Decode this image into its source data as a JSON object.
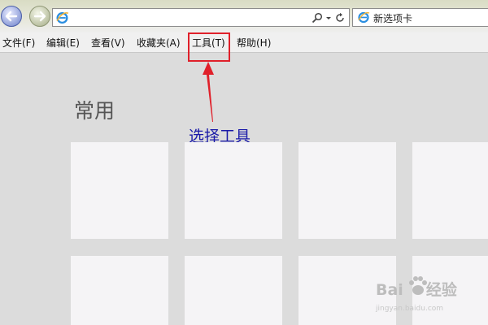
{
  "tab": {
    "title": "新选项卡"
  },
  "address": {
    "value": ""
  },
  "menu": [
    {
      "label": "文件(F)"
    },
    {
      "label": "编辑(E)"
    },
    {
      "label": "查看(V)"
    },
    {
      "label": "收藏夹(A)"
    },
    {
      "label": "工具(T)"
    },
    {
      "label": "帮助(H)"
    }
  ],
  "annotation": {
    "text": "选择工具",
    "color": "#1a1aa8",
    "highlight_color": "#e0202a"
  },
  "section": {
    "title": "常用"
  },
  "tiles_count": 8,
  "watermark": {
    "brand": "Bai",
    "suffix": "经验",
    "sub": "jingyan.baidu.com"
  }
}
